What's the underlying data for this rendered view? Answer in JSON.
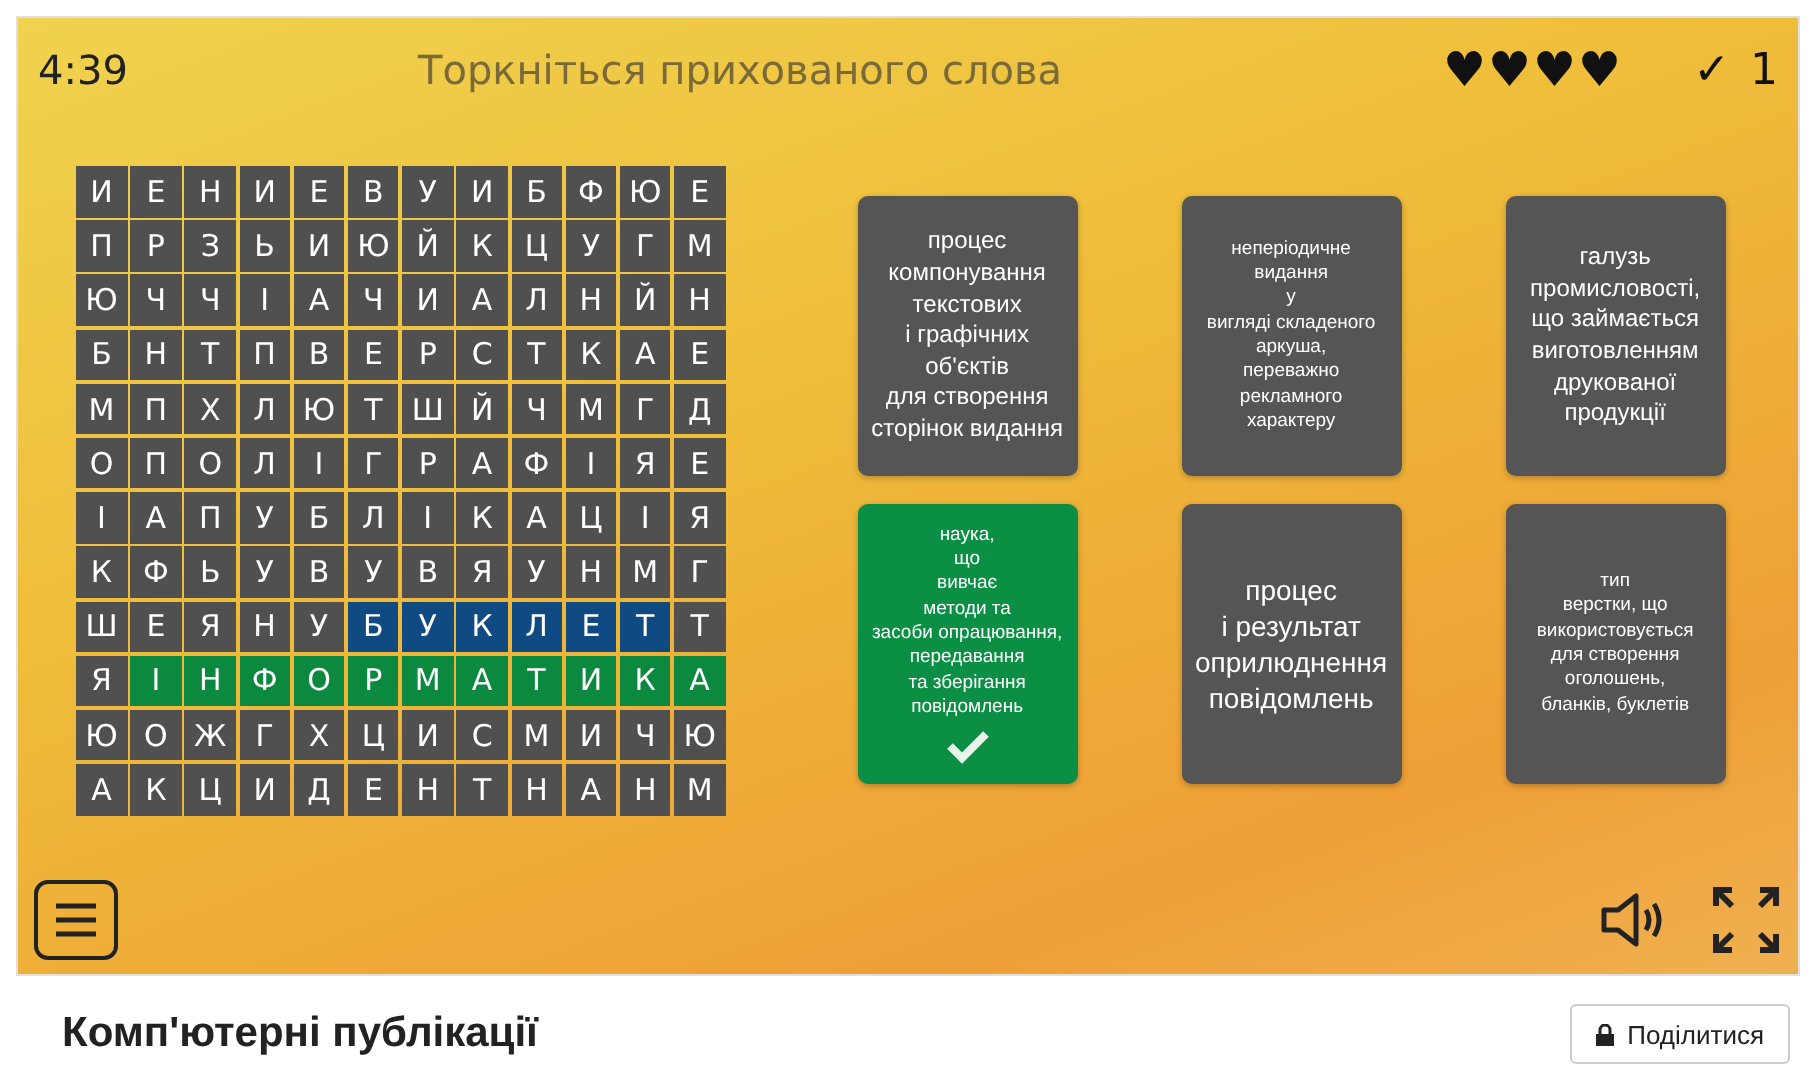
{
  "header": {
    "timer": "4:39",
    "instruction": "Торкніться прихованого слова",
    "lives": [
      "♥",
      "♥",
      "♥",
      "♥"
    ],
    "score_mark": "✓",
    "score": "1"
  },
  "grid": {
    "rows": [
      {
        "cells": [
          {
            "letter": "И",
            "selected": false,
            "found": false
          },
          {
            "letter": "Е",
            "selected": false,
            "found": false
          },
          {
            "letter": "Н",
            "selected": false,
            "found": false
          },
          {
            "letter": "И",
            "selected": false,
            "found": false
          },
          {
            "letter": "Е",
            "selected": false,
            "found": false
          },
          {
            "letter": "В",
            "selected": false,
            "found": false
          },
          {
            "letter": "У",
            "selected": false,
            "found": false
          },
          {
            "letter": "И",
            "selected": false,
            "found": false
          },
          {
            "letter": "Б",
            "selected": false,
            "found": false
          },
          {
            "letter": "Ф",
            "selected": false,
            "found": false
          },
          {
            "letter": "Ю",
            "selected": false,
            "found": false
          },
          {
            "letter": "Е",
            "selected": false,
            "found": false
          }
        ]
      },
      {
        "cells": [
          {
            "letter": "П",
            "selected": false,
            "found": false
          },
          {
            "letter": "Р",
            "selected": false,
            "found": false
          },
          {
            "letter": "З",
            "selected": false,
            "found": false
          },
          {
            "letter": "Ь",
            "selected": false,
            "found": false
          },
          {
            "letter": "И",
            "selected": false,
            "found": false
          },
          {
            "letter": "Ю",
            "selected": false,
            "found": false
          },
          {
            "letter": "Й",
            "selected": false,
            "found": false
          },
          {
            "letter": "К",
            "selected": false,
            "found": false
          },
          {
            "letter": "Ц",
            "selected": false,
            "found": false
          },
          {
            "letter": "У",
            "selected": false,
            "found": false
          },
          {
            "letter": "Г",
            "selected": false,
            "found": false
          },
          {
            "letter": "М",
            "selected": false,
            "found": false
          }
        ]
      },
      {
        "cells": [
          {
            "letter": "Ю",
            "selected": false,
            "found": false
          },
          {
            "letter": "Ч",
            "selected": false,
            "found": false
          },
          {
            "letter": "Ч",
            "selected": false,
            "found": false
          },
          {
            "letter": "І",
            "selected": false,
            "found": false
          },
          {
            "letter": "А",
            "selected": false,
            "found": false
          },
          {
            "letter": "Ч",
            "selected": false,
            "found": false
          },
          {
            "letter": "И",
            "selected": false,
            "found": false
          },
          {
            "letter": "А",
            "selected": false,
            "found": false
          },
          {
            "letter": "Л",
            "selected": false,
            "found": false
          },
          {
            "letter": "Н",
            "selected": false,
            "found": false
          },
          {
            "letter": "Й",
            "selected": false,
            "found": false
          },
          {
            "letter": "Н",
            "selected": false,
            "found": false
          }
        ]
      },
      {
        "cells": [
          {
            "letter": "Б",
            "selected": false,
            "found": false
          },
          {
            "letter": "Н",
            "selected": false,
            "found": false
          },
          {
            "letter": "Т",
            "selected": false,
            "found": false
          },
          {
            "letter": "П",
            "selected": false,
            "found": false
          },
          {
            "letter": "В",
            "selected": false,
            "found": false
          },
          {
            "letter": "Е",
            "selected": false,
            "found": false
          },
          {
            "letter": "Р",
            "selected": false,
            "found": false
          },
          {
            "letter": "С",
            "selected": false,
            "found": false
          },
          {
            "letter": "Т",
            "selected": false,
            "found": false
          },
          {
            "letter": "К",
            "selected": false,
            "found": false
          },
          {
            "letter": "А",
            "selected": false,
            "found": false
          },
          {
            "letter": "Е",
            "selected": false,
            "found": false
          }
        ]
      },
      {
        "cells": [
          {
            "letter": "М",
            "selected": false,
            "found": false
          },
          {
            "letter": "П",
            "selected": false,
            "found": false
          },
          {
            "letter": "Х",
            "selected": false,
            "found": false
          },
          {
            "letter": "Л",
            "selected": false,
            "found": false
          },
          {
            "letter": "Ю",
            "selected": false,
            "found": false
          },
          {
            "letter": "Т",
            "selected": false,
            "found": false
          },
          {
            "letter": "Ш",
            "selected": false,
            "found": false
          },
          {
            "letter": "Й",
            "selected": false,
            "found": false
          },
          {
            "letter": "Ч",
            "selected": false,
            "found": false
          },
          {
            "letter": "М",
            "selected": false,
            "found": false
          },
          {
            "letter": "Г",
            "selected": false,
            "found": false
          },
          {
            "letter": "Д",
            "selected": false,
            "found": false
          }
        ]
      },
      {
        "cells": [
          {
            "letter": "О",
            "selected": false,
            "found": false
          },
          {
            "letter": "П",
            "selected": false,
            "found": false
          },
          {
            "letter": "О",
            "selected": false,
            "found": false
          },
          {
            "letter": "Л",
            "selected": false,
            "found": false
          },
          {
            "letter": "І",
            "selected": false,
            "found": false
          },
          {
            "letter": "Г",
            "selected": false,
            "found": false
          },
          {
            "letter": "Р",
            "selected": false,
            "found": false
          },
          {
            "letter": "А",
            "selected": false,
            "found": false
          },
          {
            "letter": "Ф",
            "selected": false,
            "found": false
          },
          {
            "letter": "І",
            "selected": false,
            "found": false
          },
          {
            "letter": "Я",
            "selected": false,
            "found": false
          },
          {
            "letter": "Е",
            "selected": false,
            "found": false
          }
        ]
      },
      {
        "cells": [
          {
            "letter": "І",
            "selected": false,
            "found": false
          },
          {
            "letter": "А",
            "selected": false,
            "found": false
          },
          {
            "letter": "П",
            "selected": false,
            "found": false
          },
          {
            "letter": "У",
            "selected": false,
            "found": false
          },
          {
            "letter": "Б",
            "selected": false,
            "found": false
          },
          {
            "letter": "Л",
            "selected": false,
            "found": false
          },
          {
            "letter": "І",
            "selected": false,
            "found": false
          },
          {
            "letter": "К",
            "selected": false,
            "found": false
          },
          {
            "letter": "А",
            "selected": false,
            "found": false
          },
          {
            "letter": "Ц",
            "selected": false,
            "found": false
          },
          {
            "letter": "І",
            "selected": false,
            "found": false
          },
          {
            "letter": "Я",
            "selected": false,
            "found": false
          }
        ]
      },
      {
        "cells": [
          {
            "letter": "К",
            "selected": false,
            "found": false
          },
          {
            "letter": "Ф",
            "selected": false,
            "found": false
          },
          {
            "letter": "Ь",
            "selected": false,
            "found": false
          },
          {
            "letter": "У",
            "selected": false,
            "found": false
          },
          {
            "letter": "В",
            "selected": false,
            "found": false
          },
          {
            "letter": "У",
            "selected": false,
            "found": false
          },
          {
            "letter": "В",
            "selected": false,
            "found": false
          },
          {
            "letter": "Я",
            "selected": false,
            "found": false
          },
          {
            "letter": "У",
            "selected": false,
            "found": false
          },
          {
            "letter": "Н",
            "selected": false,
            "found": false
          },
          {
            "letter": "М",
            "selected": false,
            "found": false
          },
          {
            "letter": "Г",
            "selected": false,
            "found": false
          }
        ]
      },
      {
        "cells": [
          {
            "letter": "Ш",
            "selected": false,
            "found": false
          },
          {
            "letter": "Е",
            "selected": false,
            "found": false
          },
          {
            "letter": "Я",
            "selected": false,
            "found": false
          },
          {
            "letter": "Н",
            "selected": false,
            "found": false
          },
          {
            "letter": "У",
            "selected": false,
            "found": false
          },
          {
            "letter": "Б",
            "selected": true,
            "found": false
          },
          {
            "letter": "У",
            "selected": true,
            "found": false
          },
          {
            "letter": "К",
            "selected": true,
            "found": false
          },
          {
            "letter": "Л",
            "selected": true,
            "found": false
          },
          {
            "letter": "Е",
            "selected": true,
            "found": false
          },
          {
            "letter": "Т",
            "selected": true,
            "found": false
          },
          {
            "letter": "Т",
            "selected": false,
            "found": false
          }
        ]
      },
      {
        "cells": [
          {
            "letter": "Я",
            "selected": false,
            "found": false
          },
          {
            "letter": "І",
            "selected": false,
            "found": true
          },
          {
            "letter": "Н",
            "selected": false,
            "found": true
          },
          {
            "letter": "Ф",
            "selected": false,
            "found": true
          },
          {
            "letter": "О",
            "selected": false,
            "found": true
          },
          {
            "letter": "Р",
            "selected": false,
            "found": true
          },
          {
            "letter": "М",
            "selected": false,
            "found": true
          },
          {
            "letter": "А",
            "selected": false,
            "found": true
          },
          {
            "letter": "Т",
            "selected": false,
            "found": true
          },
          {
            "letter": "И",
            "selected": false,
            "found": true
          },
          {
            "letter": "К",
            "selected": false,
            "found": true
          },
          {
            "letter": "А",
            "selected": false,
            "found": true
          }
        ]
      },
      {
        "cells": [
          {
            "letter": "Ю",
            "selected": false,
            "found": false
          },
          {
            "letter": "О",
            "selected": false,
            "found": false
          },
          {
            "letter": "Ж",
            "selected": false,
            "found": false
          },
          {
            "letter": "Г",
            "selected": false,
            "found": false
          },
          {
            "letter": "Х",
            "selected": false,
            "found": false
          },
          {
            "letter": "Ц",
            "selected": false,
            "found": false
          },
          {
            "letter": "И",
            "selected": false,
            "found": false
          },
          {
            "letter": "С",
            "selected": false,
            "found": false
          },
          {
            "letter": "М",
            "selected": false,
            "found": false
          },
          {
            "letter": "И",
            "selected": false,
            "found": false
          },
          {
            "letter": "Ч",
            "selected": false,
            "found": false
          },
          {
            "letter": "Ю",
            "selected": false,
            "found": false
          }
        ]
      },
      {
        "cells": [
          {
            "letter": "А",
            "selected": false,
            "found": false
          },
          {
            "letter": "К",
            "selected": false,
            "found": false
          },
          {
            "letter": "Ц",
            "selected": false,
            "found": false
          },
          {
            "letter": "И",
            "selected": false,
            "found": false
          },
          {
            "letter": "Д",
            "selected": false,
            "found": false
          },
          {
            "letter": "Е",
            "selected": false,
            "found": false
          },
          {
            "letter": "Н",
            "selected": false,
            "found": false
          },
          {
            "letter": "Т",
            "selected": false,
            "found": false
          },
          {
            "letter": "Н",
            "selected": false,
            "found": false
          },
          {
            "letter": "А",
            "selected": false,
            "found": false
          },
          {
            "letter": "Н",
            "selected": false,
            "found": false
          },
          {
            "letter": "М",
            "selected": false,
            "found": false
          }
        ]
      }
    ]
  },
  "cards": [
    {
      "text": "процес\nкомпонування\nтекстових\nі графічних\nоб'єктів\nдля створення\nсторінок видання",
      "found": false
    },
    {
      "text": "неперіодичне\nвидання\nу\nвигляді складеного\nаркуша,\nпереважно\nрекламного\nхарактеру",
      "found": false
    },
    {
      "text": "галузь\nпромисловості,\nщо займається\nвиготовленням\nдрукованої\nпродукції",
      "found": false
    },
    {
      "text": "наука,\nщо\nвивчає\nметоди та\nзасоби опрацювання,\nпередавання\nта зберігання\nповідомлень",
      "found": true
    },
    {
      "text": "процес\nі результат\nоприлюднення\nповідомлень",
      "found": false
    },
    {
      "text": "тип\nверстки, що\nвикористовується\nдля створення\nоголошень,\nбланків, буклетів",
      "found": false
    }
  ],
  "footer": {
    "title": "Комп'ютерні публікації",
    "share_button": "Поділитися"
  }
}
